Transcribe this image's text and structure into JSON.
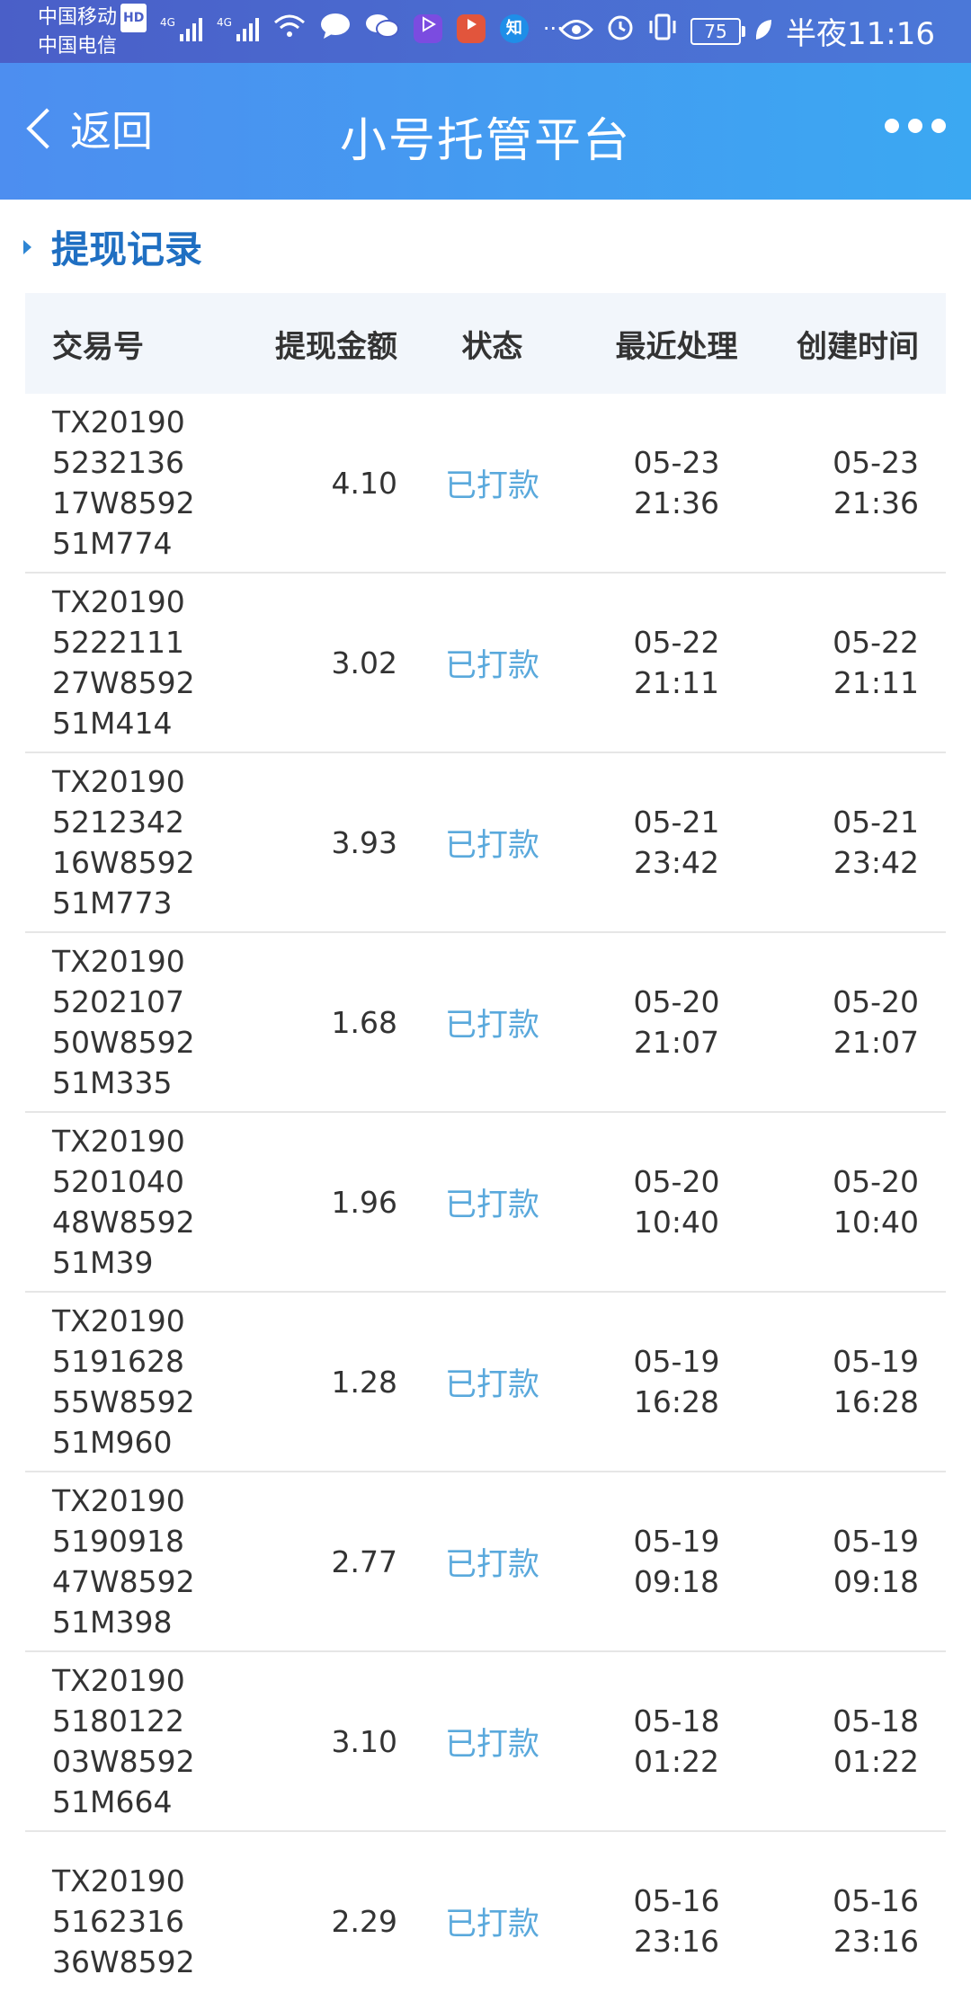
{
  "status_bar": {
    "carrier_1": "中国移动",
    "carrier_1_badge": "HD",
    "carrier_2": "中国电信",
    "network_1": "4G",
    "network_2": "4G",
    "battery": "75",
    "time": "半夜11:16",
    "icons": [
      "signal-icon",
      "signal-icon",
      "wifi-icon",
      "chat-bubble-icon",
      "wechat-icon",
      "video-app-icon",
      "play-app-icon",
      "zhihu-icon",
      "ellipsis-icon",
      "eye-icon",
      "alarm-icon",
      "vibrate-icon",
      "battery-icon",
      "leaf-icon"
    ],
    "zhihu_label": "知",
    "ellipsis": "···"
  },
  "navbar": {
    "back_label": "返回",
    "title": "小号托管平台"
  },
  "section": {
    "title": "提现记录"
  },
  "table": {
    "headers": [
      "交易号",
      "提现金额",
      "状态",
      "最近处理",
      "创建时间"
    ],
    "rows": [
      {
        "id_lines": [
          "TX20190",
          "5232136",
          "17W8592",
          "51M774"
        ],
        "amount": "4.10",
        "status": "已打款",
        "processed": [
          "05-23",
          "21:36"
        ],
        "created": [
          "05-23",
          "21:36"
        ]
      },
      {
        "id_lines": [
          "TX20190",
          "5222111",
          "27W8592",
          "51M414"
        ],
        "amount": "3.02",
        "status": "已打款",
        "processed": [
          "05-22",
          "21:11"
        ],
        "created": [
          "05-22",
          "21:11"
        ]
      },
      {
        "id_lines": [
          "TX20190",
          "5212342",
          "16W8592",
          "51M773"
        ],
        "amount": "3.93",
        "status": "已打款",
        "processed": [
          "05-21",
          "23:42"
        ],
        "created": [
          "05-21",
          "23:42"
        ]
      },
      {
        "id_lines": [
          "TX20190",
          "5202107",
          "50W8592",
          "51M335"
        ],
        "amount": "1.68",
        "status": "已打款",
        "processed": [
          "05-20",
          "21:07"
        ],
        "created": [
          "05-20",
          "21:07"
        ]
      },
      {
        "id_lines": [
          "TX20190",
          "5201040",
          "48W8592",
          "51M39"
        ],
        "amount": "1.96",
        "status": "已打款",
        "processed": [
          "05-20",
          "10:40"
        ],
        "created": [
          "05-20",
          "10:40"
        ]
      },
      {
        "id_lines": [
          "TX20190",
          "5191628",
          "55W8592",
          "51M960"
        ],
        "amount": "1.28",
        "status": "已打款",
        "processed": [
          "05-19",
          "16:28"
        ],
        "created": [
          "05-19",
          "16:28"
        ]
      },
      {
        "id_lines": [
          "TX20190",
          "5190918",
          "47W8592",
          "51M398"
        ],
        "amount": "2.77",
        "status": "已打款",
        "processed": [
          "05-19",
          "09:18"
        ],
        "created": [
          "05-19",
          "09:18"
        ]
      },
      {
        "id_lines": [
          "TX20190",
          "5180122",
          "03W8592",
          "51M664"
        ],
        "amount": "3.10",
        "status": "已打款",
        "processed": [
          "05-18",
          "01:22"
        ],
        "created": [
          "05-18",
          "01:22"
        ]
      },
      {
        "id_lines": [
          "TX20190",
          "5162316",
          "36W8592",
          ""
        ],
        "amount": "2.29",
        "status": "已打款",
        "processed": [
          "05-16",
          "23:16"
        ],
        "created": [
          "05-16",
          "23:16"
        ]
      }
    ]
  },
  "colors": {
    "statusbar_bg": "#4a5fc8",
    "navbar_bg": "#4d8ef0",
    "section_title": "#1f6fc2",
    "status_paid": "#5aa9dc",
    "header_bg": "#f2f6fb"
  }
}
